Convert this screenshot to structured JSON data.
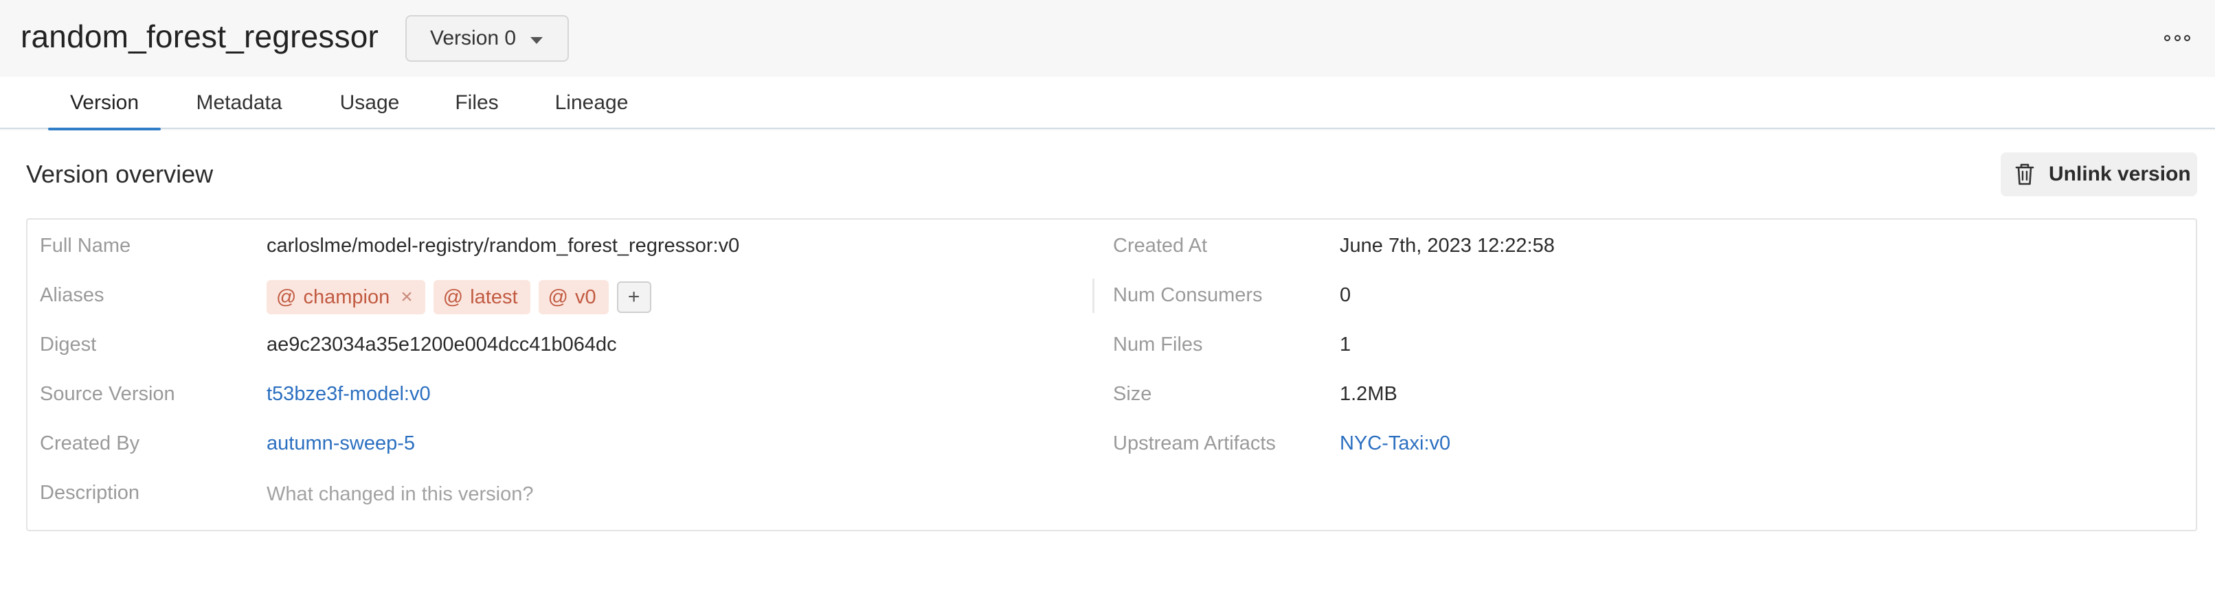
{
  "header": {
    "title": "random_forest_regressor",
    "version_selected": "Version 0"
  },
  "tabs": [
    {
      "label": "Version",
      "active": true
    },
    {
      "label": "Metadata",
      "active": false
    },
    {
      "label": "Usage",
      "active": false
    },
    {
      "label": "Files",
      "active": false
    },
    {
      "label": "Lineage",
      "active": false
    }
  ],
  "overview": {
    "title": "Version overview",
    "unlink_label": "Unlink version",
    "left": {
      "full_name": {
        "label": "Full Name",
        "value": "carloslme/model-registry/random_forest_regressor:v0"
      },
      "aliases": {
        "label": "Aliases",
        "items": [
          {
            "prefix": "@",
            "name": "champion",
            "removable": "×"
          },
          {
            "prefix": "@",
            "name": "latest"
          },
          {
            "prefix": "@",
            "name": "v0"
          }
        ],
        "add": "+"
      },
      "digest": {
        "label": "Digest",
        "value": "ae9c23034a35e1200e004dcc41b064dc"
      },
      "source_version": {
        "label": "Source Version",
        "value": "t53bze3f-model:v0"
      },
      "created_by": {
        "label": "Created By",
        "value": "autumn-sweep-5"
      },
      "description": {
        "label": "Description",
        "placeholder": "What changed in this version?"
      }
    },
    "right": {
      "created_at": {
        "label": "Created At",
        "value": "June 7th, 2023 12:22:58"
      },
      "num_consumers": {
        "label": "Num Consumers",
        "value": "0"
      },
      "num_files": {
        "label": "Num Files",
        "value": "1"
      },
      "size": {
        "label": "Size",
        "value": "1.2MB"
      },
      "upstream_artifacts": {
        "label": "Upstream Artifacts",
        "value": "NYC-Taxi:v0"
      }
    }
  },
  "colors": {
    "accent": "#2f7ec7",
    "link": "#2b6fc0",
    "alias_bg": "#fbe6df",
    "alias_text": "#c15a41"
  },
  "icons": [
    "caret-down-icon",
    "more-options-icon",
    "trash-icon",
    "close-icon",
    "plus-icon"
  ]
}
